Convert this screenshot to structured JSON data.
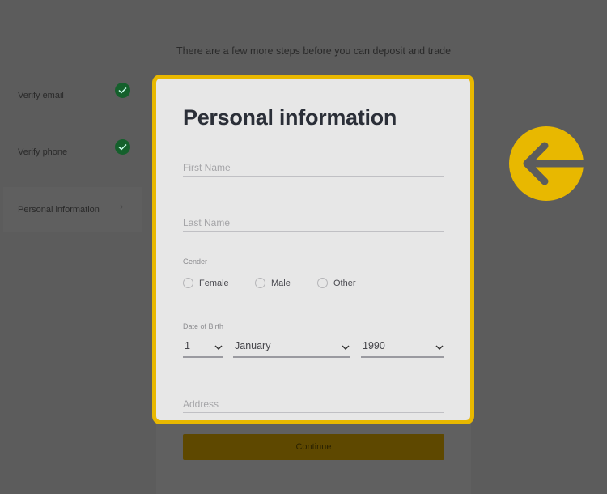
{
  "subtitle": "There are a few more steps before you can deposit and trade",
  "steps": [
    {
      "label": "Verify email",
      "status": "done"
    },
    {
      "label": "Verify phone",
      "status": "done"
    },
    {
      "label": "Personal information",
      "status": "current"
    }
  ],
  "form": {
    "title": "Personal information",
    "first_name_placeholder": "First Name",
    "last_name_placeholder": "Last Name",
    "gender_label": "Gender",
    "gender_options": [
      "Female",
      "Male",
      "Other"
    ],
    "dob_label": "Date of Birth",
    "day": "1",
    "month": "January",
    "year": "1990",
    "address_placeholder": "Address",
    "continue_label": "Continue"
  },
  "colors": {
    "highlight": "#e8b800",
    "check": "#15602c"
  },
  "annotation_icon": "arrow-left-circle-icon"
}
